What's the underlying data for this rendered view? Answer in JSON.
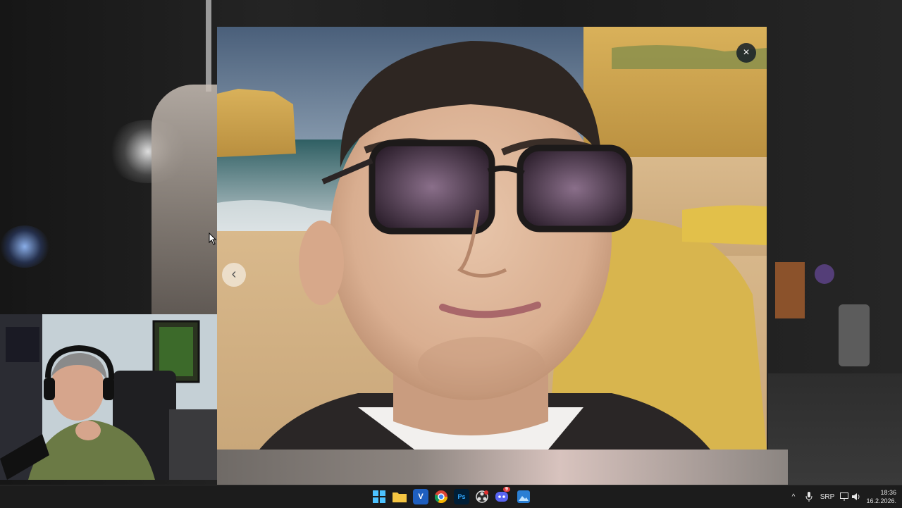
{
  "viewer": {
    "close_glyph": "×",
    "prev_glyph": "‹"
  },
  "taskbar": {
    "apps": [
      {
        "name": "start-icon"
      },
      {
        "name": "file-explorer-icon"
      },
      {
        "name": "v-app-icon",
        "label": "V"
      },
      {
        "name": "chrome-icon"
      },
      {
        "name": "photoshop-icon",
        "label": "Ps"
      },
      {
        "name": "obs-icon"
      },
      {
        "name": "discord-icon",
        "badge": "9"
      },
      {
        "name": "image-viewer-icon"
      }
    ],
    "tray": {
      "chevron": "^",
      "language": "SRP"
    },
    "clock": {
      "time": "18:36",
      "date": "16.2.2026."
    }
  },
  "colors": {
    "taskbar_bg": "#1c1c1c",
    "close_button_bg": "#1b2631"
  }
}
